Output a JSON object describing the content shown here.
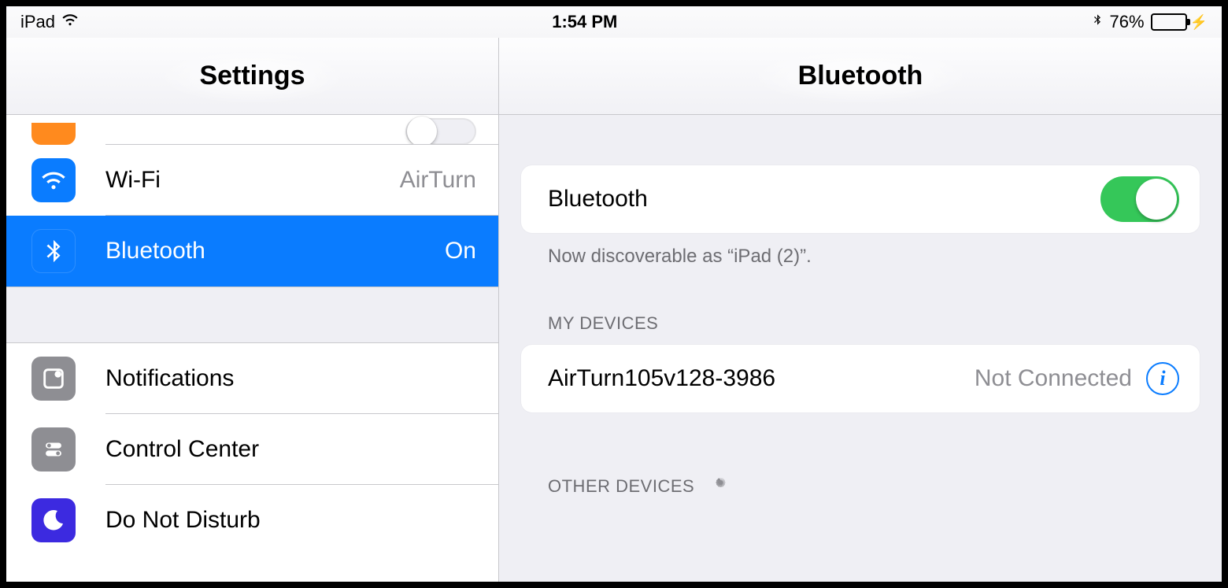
{
  "statusbar": {
    "device_name": "iPad",
    "time": "1:54 PM",
    "battery_pct": "76%",
    "battery_fill_pct": 76
  },
  "sidebar": {
    "title": "Settings",
    "items": [
      {
        "icon": "airplane-icon",
        "label": "",
        "detail": "",
        "bg": "bg-orange"
      },
      {
        "icon": "wifi-icon",
        "label": "Wi-Fi",
        "detail": "AirTurn",
        "bg": "bg-blue"
      },
      {
        "icon": "bluetooth-icon",
        "label": "Bluetooth",
        "detail": "On",
        "bg": "bg-blue",
        "selected": true
      },
      {
        "icon": "notifications-icon",
        "label": "Notifications",
        "detail": "",
        "bg": "bg-gray"
      },
      {
        "icon": "control-center-icon",
        "label": "Control Center",
        "detail": "",
        "bg": "bg-gray"
      },
      {
        "icon": "dnd-icon",
        "label": "Do Not Disturb",
        "detail": "",
        "bg": "bg-indigo"
      }
    ]
  },
  "detail": {
    "title": "Bluetooth",
    "toggle": {
      "label": "Bluetooth",
      "on": true
    },
    "discoverable_text": "Now discoverable as “iPad (2)”.",
    "my_devices": {
      "header": "MY DEVICES",
      "items": [
        {
          "name": "AirTurn105v128-3986",
          "status": "Not Connected"
        }
      ]
    },
    "other_devices": {
      "header": "OTHER DEVICES"
    }
  }
}
